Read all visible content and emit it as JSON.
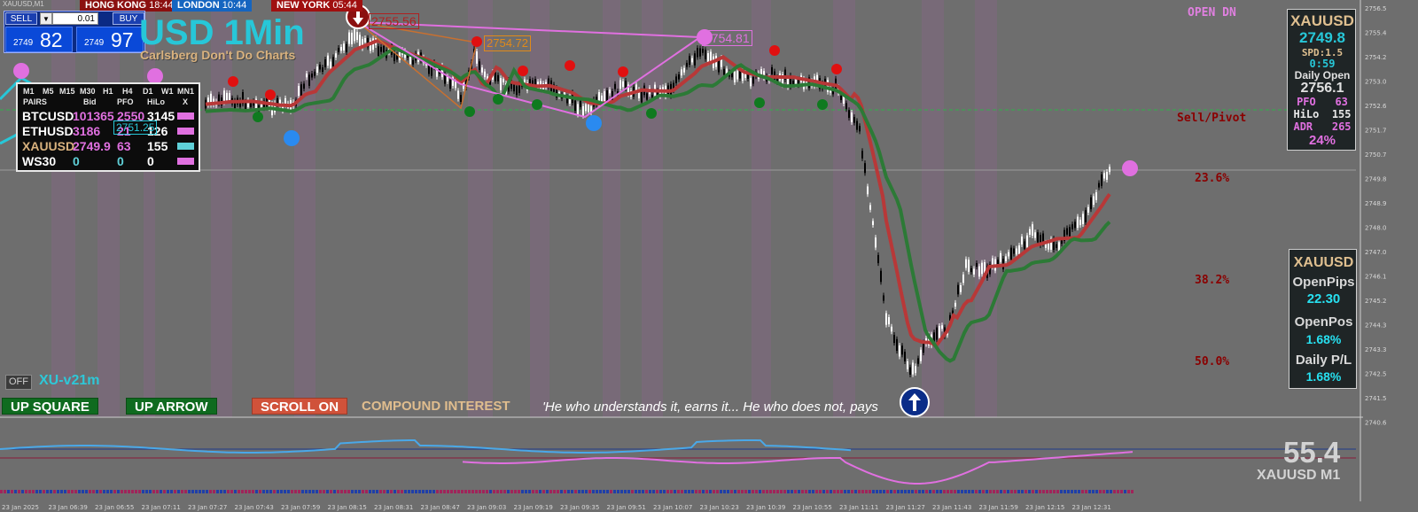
{
  "window": {
    "symbol_tab": "XAUUSD,M1"
  },
  "sessions": [
    {
      "name": "HONG KONG",
      "time": "18:44",
      "bg": "#8b1010"
    },
    {
      "name": "LONDON",
      "time": "10:44",
      "bg": "#1565c0"
    },
    {
      "name": "NEW YORK",
      "time": "05:44",
      "bg": "#a01010"
    }
  ],
  "trade_panel": {
    "sell_label": "SELL",
    "buy_label": "BUY",
    "lot_value": "0.01",
    "sell_price_small": "2749",
    "sell_price_big": "82",
    "buy_price_small": "2749",
    "buy_price_big": "97"
  },
  "title": "USD 1Min",
  "subtitle": "Carlsberg Don't Do Charts",
  "pairs_panel": {
    "timeframes": [
      "M1",
      "M5",
      "M15",
      "M30",
      "H1",
      "H4",
      "D1",
      "W1",
      "MN1"
    ],
    "headers": [
      "PAIRS",
      "Bid",
      "PFO",
      "HiLo",
      "X"
    ],
    "rows": [
      {
        "pair": "BTCUSD",
        "bid": "101365",
        "pfo": "2550",
        "hilo": "3145",
        "pair_color": "#ffffff",
        "bid_color": "#e070e0",
        "pfo_color": "#e070e0",
        "hilo_color": "#ffffff",
        "swatch": "#e070e0"
      },
      {
        "pair": "ETHUSD",
        "bid": "3186",
        "pfo": "21",
        "hilo": "126",
        "pair_color": "#ffffff",
        "bid_color": "#e070e0",
        "pfo_color": "#e070e0",
        "hilo_color": "#ffffff",
        "swatch": "#e070e0"
      },
      {
        "pair": "XAUUSD",
        "bid": "2749.9",
        "pfo": "63",
        "hilo": "155",
        "pair_color": "#d9b27e",
        "bid_color": "#e070e0",
        "pfo_color": "#e070e0",
        "hilo_color": "#ffffff",
        "swatch": "#5fd0d8"
      },
      {
        "pair": "WS30",
        "bid": "0",
        "pfo": "0",
        "hilo": "0",
        "pair_color": "#ffffff",
        "bid_color": "#5fd0d8",
        "pfo_color": "#5fd0d8",
        "hilo_color": "#ffffff",
        "swatch": "#e070e0"
      }
    ]
  },
  "price_labels": {
    "top_left": "2755.56",
    "mid": "2754.72",
    "right": "2754.81",
    "overlay": "2751.25"
  },
  "open_dn": "OPEN DN",
  "sell_pivot": "Sell/Pivot",
  "fib_levels": [
    "23.6%",
    "38.2%",
    "50.0%"
  ],
  "xau_panel": {
    "symbol": "XAUUSD",
    "price": "2749.8",
    "spd": "SPD:1.5",
    "timer": "0:59",
    "daily_open_label": "Daily Open",
    "daily_open": "2756.1",
    "pfo_label": "PFO",
    "pfo": "63",
    "hilo_label": "HiLo",
    "hilo": "155",
    "adr_label": "ADR",
    "adr": "265",
    "adr_pct": "24%"
  },
  "pips_panel": {
    "symbol": "XAUUSD",
    "open_pips_label": "OpenPips",
    "open_pips": "22.30",
    "open_pos_label": "OpenPos",
    "open_pos": "1.68%",
    "daily_pl_label": "Daily P/L",
    "daily_pl": "1.68%"
  },
  "controls": {
    "off_label": "OFF",
    "version": "XU-v21m",
    "up_square": "UP SQUARE",
    "up_arrow": "UP ARROW",
    "scroll_on": "SCROLL ON",
    "compound": "COMPOUND INTEREST",
    "quote": "'He who understands it, earns it... He who does not, pays"
  },
  "oscillator": {
    "value": "55.4",
    "symbol": "XAUUSD M1"
  },
  "y_axis_labels": [
    "2756.5",
    "2755.4",
    "2754.2",
    "2753.0",
    "2752.6",
    "2751.7",
    "2750.7",
    "2749.8",
    "2748.9",
    "2748.0",
    "2747.0",
    "2746.1",
    "2745.2",
    "2744.3",
    "2743.3",
    "2742.5",
    "2741.5",
    "2740.6"
  ],
  "x_axis_labels": [
    "23 Jan 2025",
    "23 Jan 06:39",
    "23 Jan 06:55",
    "23 Jan 07:11",
    "23 Jan 07:27",
    "23 Jan 07:43",
    "23 Jan 07:59",
    "23 Jan 08:15",
    "23 Jan 08:31",
    "23 Jan 08:47",
    "23 Jan 09:03",
    "23 Jan 09:19",
    "23 Jan 09:35",
    "23 Jan 09:51",
    "23 Jan 10:07",
    "23 Jan 10:23",
    "23 Jan 10:39",
    "23 Jan 10:55",
    "23 Jan 11:11",
    "23 Jan 11:27",
    "23 Jan 11:43",
    "23 Jan 11:59",
    "23 Jan 12:15",
    "23 Jan 12:31"
  ],
  "colors": {
    "bg": "#6e6e6e",
    "band": "#7a6c7a",
    "ma_red": "#c03a3a",
    "ma_green": "#2f8a3a",
    "zigzag": "#e070e0",
    "cyan": "#27c7d8",
    "sell_red": "#8a0000"
  }
}
